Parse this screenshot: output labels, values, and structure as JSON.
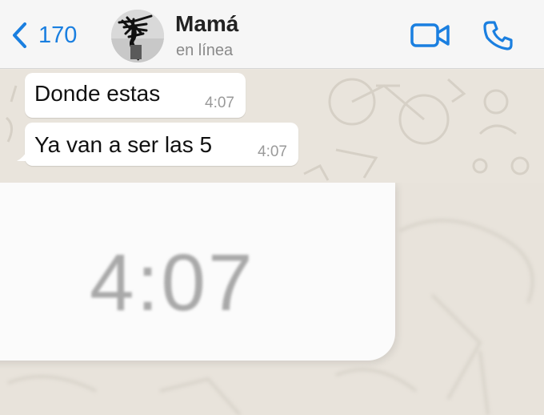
{
  "header": {
    "back_count": "170",
    "contact_name": "Mamá",
    "status": "en línea",
    "accent_color": "#1a7fe0"
  },
  "messages": [
    {
      "text": "Donde estas",
      "time": "4:07"
    },
    {
      "text": "Ya van a ser las 5",
      "time": "4:07"
    }
  ],
  "zoom": {
    "time": "4:07"
  },
  "icons": {
    "back": "chevron-left-icon",
    "video": "video-camera-icon",
    "call": "phone-icon"
  }
}
